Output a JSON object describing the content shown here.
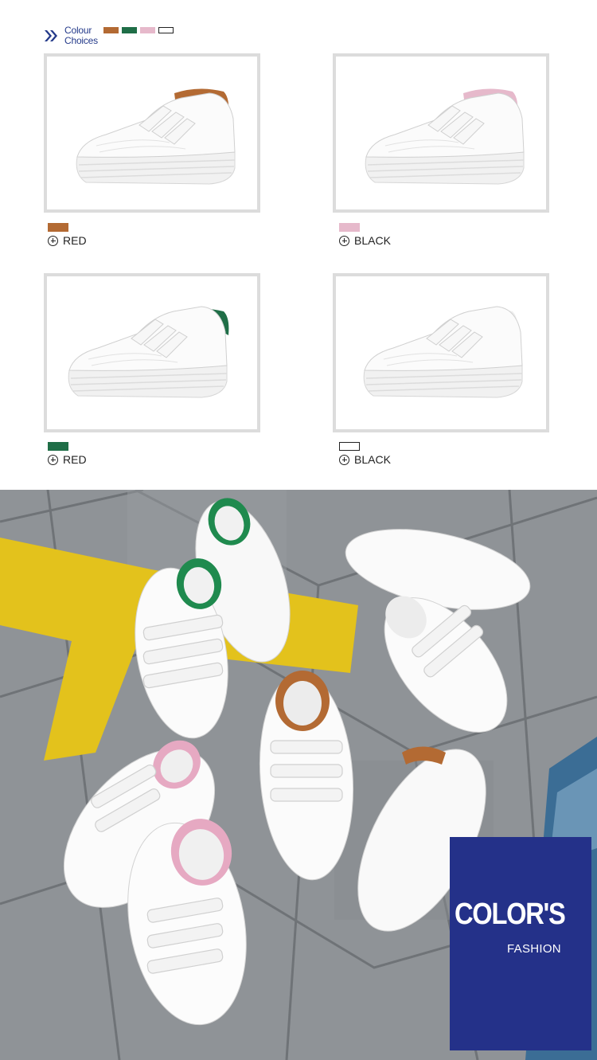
{
  "header": {
    "line1": "Colour",
    "line2": "Choices",
    "icon": "double-chevron-icon",
    "swatches": [
      "#b36a33",
      "#1f6e47",
      "#e6b9cb",
      "#ffffff"
    ]
  },
  "colors": {
    "brown": "#b36a33",
    "pink": "#e6b9cb",
    "green": "#1f6e47",
    "white": "#ffffff",
    "brand": "#243189"
  },
  "products": [
    {
      "accent": "#b36a33",
      "label": "RED"
    },
    {
      "accent": "#e6b9cb",
      "label": "BLACK"
    },
    {
      "accent": "#1f6e47",
      "label": "RED"
    },
    {
      "accent": "#ffffff",
      "label": "BLACK"
    }
  ],
  "banner": {
    "title": "COLOR'S",
    "subtitle": "FASHION"
  }
}
